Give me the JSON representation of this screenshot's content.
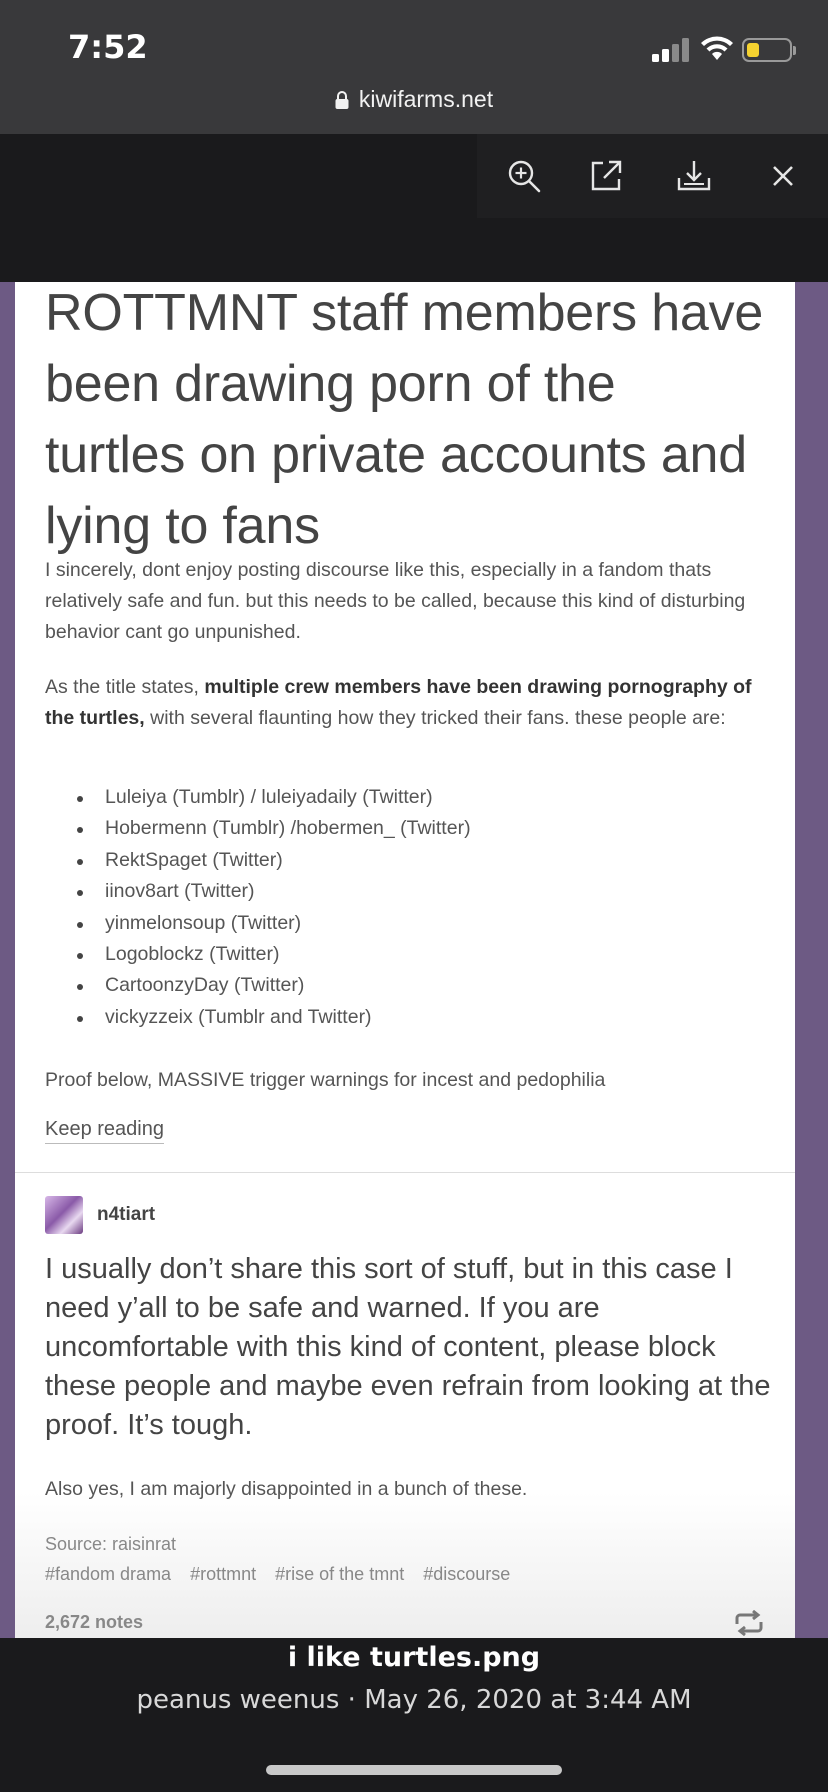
{
  "status_bar": {
    "time": "7:52"
  },
  "browser": {
    "url": "kiwifarms.net"
  },
  "viewer_toolbar": {
    "buttons": [
      "zoom-in",
      "open-external",
      "download",
      "close"
    ]
  },
  "post": {
    "title": "ROTTMNT staff members have been drawing porn of the turtles on private accounts and lying to fans",
    "intro": "I sincerely, dont enjoy posting discourse like this, especially in a fandom thats relatively safe and fun. but this needs to be called, because this kind of disturbing behavior cant go unpunished.",
    "states_prefix": "As the title states, ",
    "states_bold": "multiple crew members have been drawing pornography of the turtles,",
    "states_suffix": " with several flaunting how they tricked their fans. these people are:",
    "users": [
      "Luleiya (Tumblr) / luleiyadaily (Twitter)",
      "Hobermenn (Tumblr) /hobermen_ (Twitter)",
      "RektSpaget (Twitter)",
      "iinov8art (Twitter)",
      "yinmelonsoup (Twitter)",
      "Logoblockz (Twitter)",
      "CartoonzyDay (Twitter)",
      "vickyzzeix  (Tumblr and Twitter)"
    ],
    "proof_note": "Proof below, MASSIVE trigger warnings for incest and pedophilia",
    "keep_reading": "Keep reading",
    "reblogger": "n4tiart",
    "comment": "I usually don’t share this sort of stuff, but in this case I need y’all to be safe and warned. If you are uncomfortable with this kind of content, please block these people and maybe even refrain from looking at the proof. It’s tough.",
    "comment_small": "Also yes, I am majorly disappointed in a bunch of these.",
    "source": "Source: raisinrat",
    "tags": [
      "#fandom drama",
      "#rottmnt",
      "#rise of the tmnt",
      "#discourse"
    ],
    "notes": "2,672 notes"
  },
  "caption": {
    "filename": "i like turtles.png",
    "meta": "peanus weenus · May 26, 2020 at 3:44 AM"
  },
  "colors": {
    "frame": "#6d5a84",
    "background": "#1a1a1c",
    "battery": "#f5d230"
  }
}
